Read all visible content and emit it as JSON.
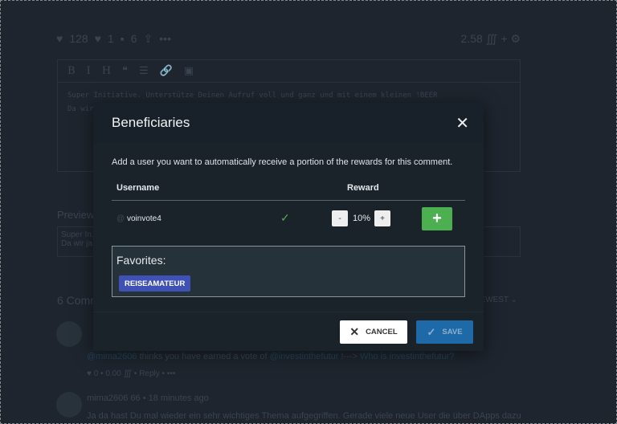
{
  "background": {
    "stats": {
      "upvotes": "128",
      "downvotes": "1",
      "comments": "6",
      "more": "•••",
      "payout": "2.58 ∭ + ⚙"
    },
    "editor": {
      "toolbar": [
        "B",
        "I",
        "H",
        "❝",
        "☰",
        "🔗",
        "▣"
      ],
      "line1": "Super Initiative. Unterstütze Deinen Aufruf voll und ganz und mit einem kleinen !BEER",
      "line2": "Da wir"
    },
    "preview_label": "Preview",
    "preview_text": "Super In...",
    "preview_text2": "Da wir ja...",
    "comments_count": "6 Comm...",
    "sort": "NEWEST ⌄",
    "comment1": {
      "mention": "@mima2606",
      "text": " thinks you have earned a vote of ",
      "link": "@investinthefutur",
      "arrow": " !---> ",
      "link2": "Who is investinthefutur?",
      "actions": "♥  0  •  0.00 ∭  •  Reply  •  •••"
    },
    "comment2": {
      "author": "mima2606",
      "rep": "66",
      "time": "18 minutes ago",
      "text": "Ja da hast Du mal wieder ein sehr wichtiges Thema aufgegriffen. Gerade viele neue User die über DApps dazu"
    }
  },
  "modal": {
    "title": "Beneficiaries",
    "description": "Add a user you want to automatically receive a portion of the rewards for this comment.",
    "columns": {
      "username": "Username",
      "reward": "Reward"
    },
    "row": {
      "at": "@",
      "username": "voinvote4",
      "reward": "10%",
      "minus": "-",
      "plus": "+",
      "add": "+"
    },
    "favorites_label": "Favorites:",
    "favorites": [
      "REISEAMATEUR"
    ],
    "cancel": "CANCEL",
    "save": "SAVE"
  },
  "colors": {
    "add": "#4caf50",
    "save": "#1e6aa8",
    "chip": "#3f51b5"
  }
}
